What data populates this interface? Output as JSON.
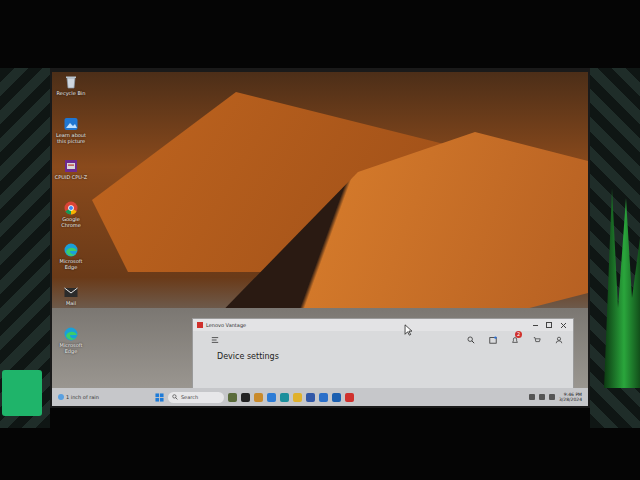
{
  "desktop_icons": [
    {
      "label": "Recycle Bin",
      "kind": "recycle"
    },
    {
      "label": "Learn about this picture",
      "kind": "picture"
    },
    {
      "label": "CPUID CPU-Z",
      "kind": "cpuz"
    },
    {
      "label": "Google Chrome",
      "kind": "chrome"
    },
    {
      "label": "Microsoft Edge",
      "kind": "edge"
    },
    {
      "label": "Mail",
      "kind": "mail"
    },
    {
      "label": "Microsoft Edge",
      "kind": "edge"
    }
  ],
  "window": {
    "title": "Lenovo Vantage",
    "heading": "Device settings",
    "notification_count": "2"
  },
  "taskbar": {
    "weather": "1 inch of rain",
    "search": {
      "placeholder": "Search"
    },
    "apps": [
      {
        "color": "#5a6b3a"
      },
      {
        "color": "#222222"
      },
      {
        "color": "#c98a2a"
      },
      {
        "color": "#2b7bd6"
      },
      {
        "color": "#1c8f9c"
      },
      {
        "color": "#e0b12c"
      },
      {
        "color": "#3158a8"
      },
      {
        "color": "#2a6fc9"
      },
      {
        "color": "#1b5fb0"
      },
      {
        "color": "#d0312d"
      }
    ],
    "time": "9:46 PM",
    "date": "3/28/2024"
  }
}
